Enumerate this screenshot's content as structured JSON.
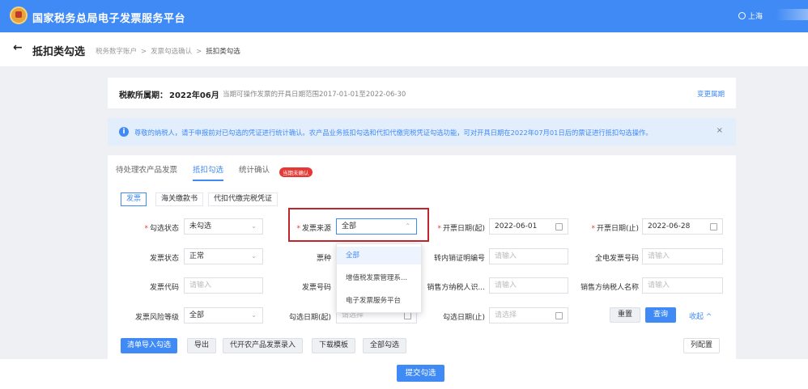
{
  "topbar": {
    "title": "国家税务总局电子发票服务平台",
    "user": "上海",
    "logo_text": "税务"
  },
  "subbar": {
    "back_glyph": "←",
    "title": "抵扣类勾选",
    "breadcrumb": [
      "税务数字账户",
      "发票勾选确认",
      "抵扣类勾选"
    ],
    "sep": ">"
  },
  "period": {
    "label": "税款所属期：",
    "value": "2022年06月",
    "hint": "当期可操作发票的开具日期范围2017-01-01至2022-06-30",
    "change_link": "变更属期"
  },
  "notice": {
    "icon": "i",
    "text": "尊敬的纳税人，请于申报前对已勾选的凭证进行统计确认。农产品业务抵扣勾选和代扣代缴完税凭证勾选功能，可对开具日期在2022年07月01日后的票证进行抵扣勾选操作。",
    "close": "×"
  },
  "tabs": [
    {
      "label": "待处理农产品发票"
    },
    {
      "label": "抵扣勾选"
    },
    {
      "label": "统计确认"
    }
  ],
  "tab_badge": "当期未确认",
  "subtabs": [
    {
      "label": "发票"
    },
    {
      "label": "海关缴款书"
    },
    {
      "label": "代扣代缴完税凭证"
    }
  ],
  "filters": {
    "required_mark": "*",
    "check_status": {
      "label": "勾选状态",
      "value": "未勾选"
    },
    "source": {
      "label": "发票来源",
      "value": "全部"
    },
    "issue_start": {
      "label": "开票日期(起)",
      "value": "2022-06-01"
    },
    "issue_end": {
      "label": "开票日期(止)",
      "value": "2022-06-28"
    },
    "invoice_status": {
      "label": "发票状态",
      "value": "正常"
    },
    "invoice_type": {
      "label": "票种"
    },
    "transfer_no": {
      "label": "转内销证明编号",
      "placeholder": "请输入"
    },
    "full_elec_no": {
      "label": "全电发票号码",
      "placeholder": "请输入"
    },
    "invoice_code": {
      "label": "发票代码",
      "placeholder": "请输入"
    },
    "invoice_no": {
      "label": "发票号码"
    },
    "seller_tax_id": {
      "label": "销售方纳税人识...",
      "placeholder": "请输入"
    },
    "seller_name": {
      "label": "销售方纳税人名称",
      "placeholder": "请输入"
    },
    "risk_level": {
      "label": "发票风险等级",
      "value": "全部"
    },
    "check_start": {
      "label": "勾选日期(起)",
      "placeholder": "请选择"
    },
    "check_end": {
      "label": "勾选日期(止)",
      "placeholder": "请选择"
    }
  },
  "dropdown": {
    "options": [
      "全部",
      "增值税发票管理系...",
      "电子发票服务平台"
    ],
    "selected": "全部"
  },
  "actions": {
    "reset": "重置",
    "query": "查询",
    "collapse": "收起",
    "collapse_glyph": "^",
    "import_check": "清单导入勾选",
    "export": "导出",
    "agri_entry": "代开农产品发票录入",
    "download_template": "下载模板",
    "select_all": "全部勾选",
    "column_config": "列配置",
    "submit": "提交勾选"
  },
  "colors": {
    "primary": "#3f8af5",
    "highlight": "#c0262d",
    "badge": "#e53935"
  }
}
